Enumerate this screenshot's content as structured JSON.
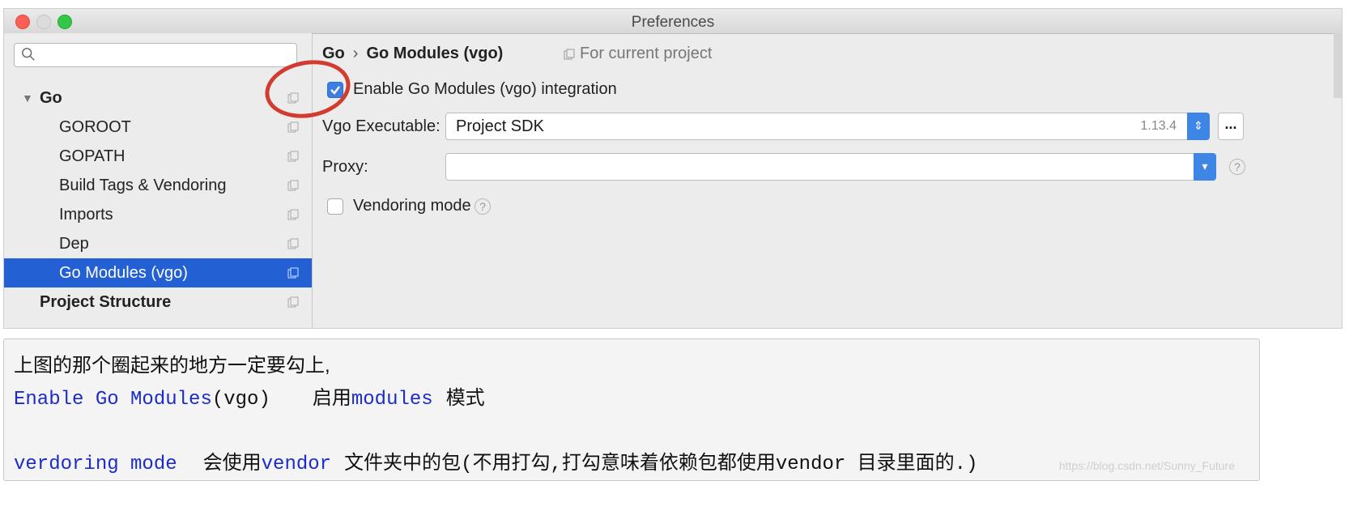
{
  "window": {
    "title": "Preferences"
  },
  "search": {
    "placeholder": ""
  },
  "sidebar": {
    "items": [
      {
        "label": "Go",
        "level": 0,
        "expanded": true,
        "bold": true,
        "selected": false
      },
      {
        "label": "GOROOT",
        "level": 1,
        "bold": false,
        "selected": false
      },
      {
        "label": "GOPATH",
        "level": 1,
        "bold": false,
        "selected": false
      },
      {
        "label": "Build Tags & Vendoring",
        "level": 1,
        "bold": false,
        "selected": false
      },
      {
        "label": "Imports",
        "level": 1,
        "bold": false,
        "selected": false
      },
      {
        "label": "Dep",
        "level": 1,
        "bold": false,
        "selected": false
      },
      {
        "label": "Go Modules (vgo)",
        "level": 1,
        "bold": false,
        "selected": true
      },
      {
        "label": "Project Structure",
        "level": 0,
        "bold": true,
        "selected": false
      }
    ]
  },
  "breadcrumb": {
    "parent": "Go",
    "separator": "›",
    "current": "Go Modules (vgo)"
  },
  "scope_label": "For current project",
  "settings": {
    "enable_modules": {
      "label": "Enable Go Modules (vgo) integration",
      "checked": true
    },
    "vgo_executable": {
      "label": "Vgo Executable:",
      "value": "Project SDK",
      "version": "1.13.4",
      "browse_label": "..."
    },
    "proxy": {
      "label": "Proxy:",
      "value": ""
    },
    "vendoring_mode": {
      "label": "Vendoring mode",
      "checked": false
    }
  },
  "note": {
    "line1": "上图的那个圈起来的地方一定要勾上,",
    "line2_code": "Enable Go Modules",
    "line2_paren": "(vgo)",
    "line2_zh1": "启用",
    "line2_code2": "modules",
    "line2_zh2": "模式",
    "line4_code": "verdoring mode",
    "line4_zh1": "会使用",
    "line4_code2": "vendor",
    "line4_zh2": "文件夹中的包",
    "line4_paren": "(不用打勾,打勾意味着依赖包都使用vendor 目录里面的.)"
  },
  "watermark": "https://blog.csdn.net/Sunny_Future",
  "colors": {
    "selection": "#2360d4",
    "accent": "#3e86e6",
    "annotation_circle": "#d23b30",
    "code_blue": "#1d2cc9"
  }
}
